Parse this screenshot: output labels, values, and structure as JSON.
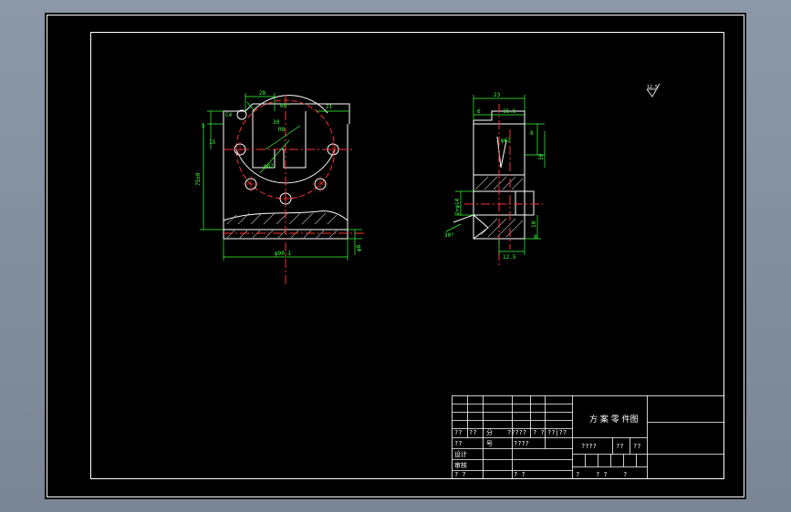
{
  "drawing": {
    "front_view": {
      "dims": {
        "top_width": "28",
        "top_right": "21",
        "angle": "60°",
        "chamfer": "C4",
        "h5": "5",
        "h15": "15",
        "h75": "75±0",
        "r30": "30",
        "r8": "R8",
        "d62": "φ62",
        "bottom_width": "φ90-1",
        "side": "φ8"
      }
    },
    "side_view": {
      "dims": {
        "top": "23",
        "d6": "6",
        "d15": "15.5",
        "d8": "8",
        "phi62": "φ62",
        "r30": "30",
        "w17": "2×φ14",
        "a30": "30°",
        "h12": "12.5",
        "h10": "10",
        "h8": "8"
      }
    },
    "roughness": "12.5"
  },
  "title_block": {
    "title": "方 案 零 件图",
    "row1": [
      "??",
      "??",
      "分",
      "?????",
      "? ?",
      "??|??"
    ],
    "row2": [
      "??",
      "号",
      "????"
    ],
    "row3": [
      "??",
      "????",
      "??",
      "??"
    ],
    "labels": [
      "设计",
      "审核"
    ],
    "row_bottom": [
      "? ?",
      "? ?",
      "?",
      "? ?",
      "?"
    ]
  }
}
